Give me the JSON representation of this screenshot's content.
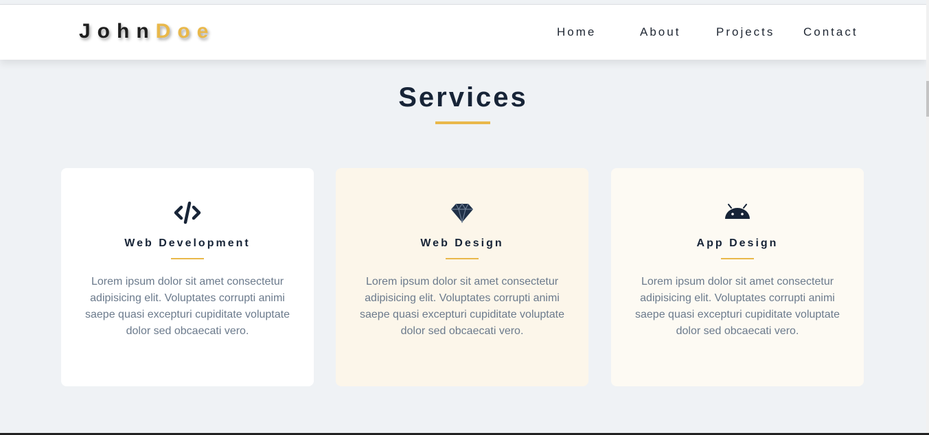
{
  "logo": {
    "first": "John",
    "second": "Doe"
  },
  "nav": {
    "items": [
      {
        "label": "Home"
      },
      {
        "label": "About"
      },
      {
        "label": "Projects"
      },
      {
        "label": "Contact"
      }
    ]
  },
  "services": {
    "title": "Services",
    "cards": [
      {
        "icon": "code-icon",
        "title": "Web Development",
        "text": "Lorem ipsum dolor sit amet consectetur adipisicing elit. Voluptates corrupti animi saepe quasi excepturi cupiditate voluptate dolor sed obcaecati vero.",
        "background": "#ffffff"
      },
      {
        "icon": "gem-icon",
        "title": "Web Design",
        "text": "Lorem ipsum dolor sit amet consectetur adipisicing elit. Voluptates corrupti animi saepe quasi excepturi cupiditate voluptate dolor sed obcaecati vero.",
        "background": "#fcf6ea"
      },
      {
        "icon": "android-icon",
        "title": "App Design",
        "text": "Lorem ipsum dolor sit amet consectetur adipisicing elit. Voluptates corrupti animi saepe quasi excepturi cupiditate voluptate dolor sed obcaecati vero.",
        "background": "#fdfaf3"
      }
    ]
  },
  "colors": {
    "accent": "#e9b84a",
    "heading": "#172437",
    "body_text": "#6b7a8c",
    "page_background": "#eff2f5"
  }
}
